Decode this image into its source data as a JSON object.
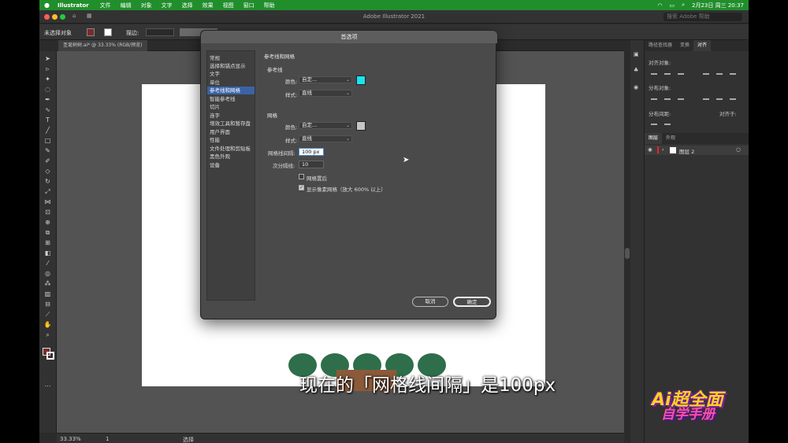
{
  "menubar": {
    "app": "Illustrator",
    "items": [
      "文件",
      "编辑",
      "对象",
      "文字",
      "选择",
      "效果",
      "视图",
      "窗口",
      "帮助"
    ],
    "datetime": "2月23日 周三  20:37"
  },
  "window": {
    "title": "Adobe Illustrator 2021",
    "search_placeholder": "搜索 Adobe 帮助"
  },
  "control_bar": {
    "no_selection": "未选择对象",
    "stroke_label": "描边:"
  },
  "document_tab": "圣诞树树.ai* @ 33.33% (RGB/预览)",
  "status_bar": {
    "zoom": "33.33%",
    "page": "1",
    "tool": "选择"
  },
  "dialog": {
    "title": "首选项",
    "categories": [
      "常规",
      "选择和锚点显示",
      "文字",
      "单位",
      "参考线和网格",
      "智能参考线",
      "切片",
      "连字",
      "增效工具和暂存盘",
      "用户界面",
      "性能",
      "文件处理和剪贴板",
      "黑色外观",
      "设备"
    ],
    "selected_category_index": 4,
    "section_title": "参考线和网格",
    "guides": {
      "header": "参考线",
      "color_label": "颜色:",
      "color_value": "自定...",
      "color_swatch": "#1be4ee",
      "style_label": "样式:",
      "style_value": "直线"
    },
    "grid": {
      "header": "网格",
      "color_label": "颜色:",
      "color_value": "自定...",
      "color_swatch": "#c6c6c6",
      "style_label": "样式:",
      "style_value": "直线",
      "gridline_every_label": "网格线间隔:",
      "gridline_every_value": "100 px",
      "subdivisions_label": "次分隔线:",
      "subdivisions_value": "10",
      "grids_in_back_label": "网格置后",
      "grids_in_back_checked": false,
      "show_pixel_grid_label": "显示像素网格（放大 600% 以上）",
      "show_pixel_grid_checked": true
    },
    "cancel_label": "取消",
    "ok_label": "确定"
  },
  "right_panel": {
    "tabs": [
      "路径查找器",
      "变换",
      "对齐"
    ],
    "align_objects_label": "对齐对象:",
    "distribute_objects_label": "分布对象:",
    "distribute_spacing_label": "分布间距:",
    "align_to_label": "对齐于:",
    "layers_tabs": [
      "图层",
      "外观"
    ],
    "layer_name": "图层 2"
  },
  "caption": "现在的「网格线间隔」是100px",
  "logo": {
    "line1": "Ai超全面",
    "line2": "自学手册"
  }
}
